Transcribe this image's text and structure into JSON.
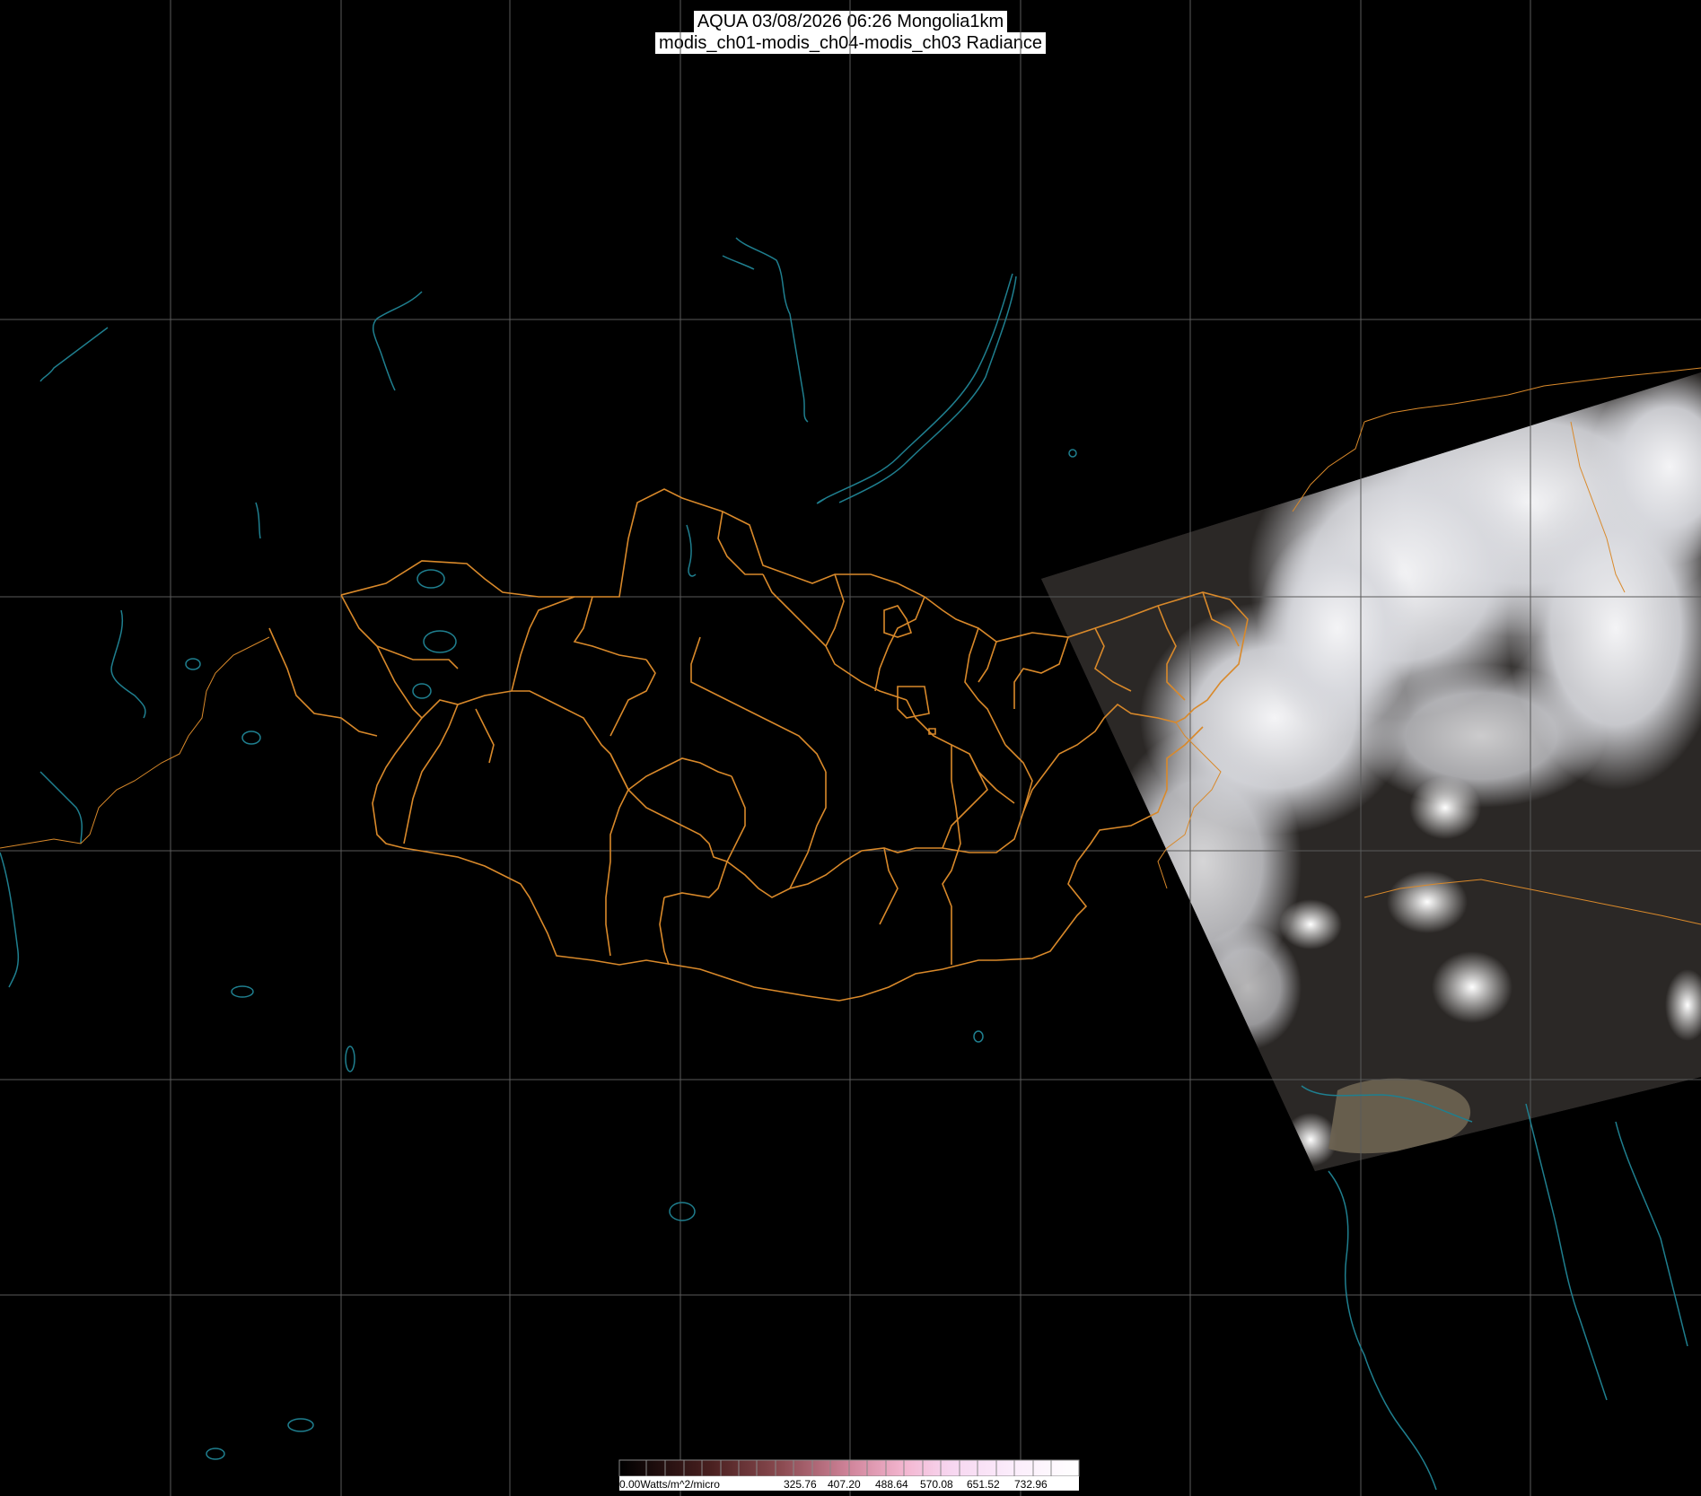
{
  "title": {
    "line1": "AQUA 03/08/2026 06:26 Mongolia1km",
    "line2": "modis_ch01-modis_ch04-modis_ch03 Radiance"
  },
  "colorbar": {
    "start_label": "0.00Watts/m^2/micro",
    "tick_labels": [
      "325.76",
      "407.20",
      "488.64",
      "570.08",
      "651.52",
      "732.96"
    ]
  },
  "colors": {
    "background": "#000000",
    "grid": "#5a5a5a",
    "coastline": "#1f7f8f",
    "border": "#d9892a",
    "cloud": "#e6e6e8",
    "land": "#2a2622"
  }
}
